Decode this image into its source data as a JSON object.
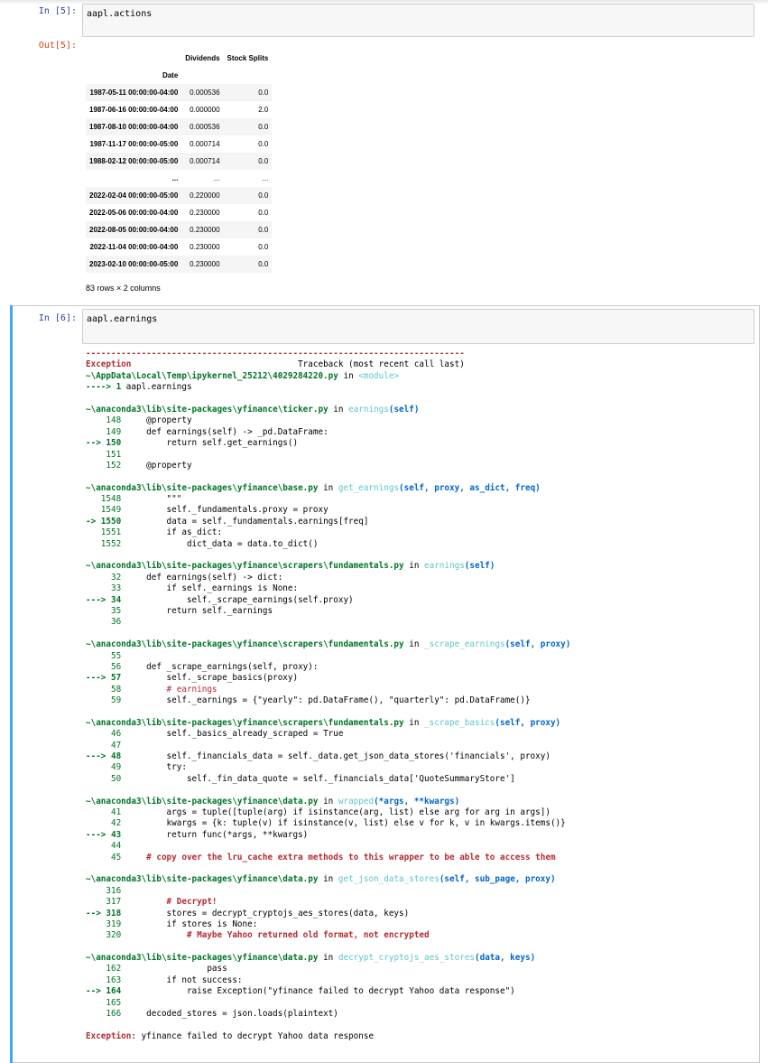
{
  "cells": [
    {
      "prompt_in": "In [5]:",
      "code": "aapl.actions",
      "prompt_out": "Out[5]:"
    },
    {
      "prompt_in": "In [6]:",
      "code": "aapl.earnings"
    }
  ],
  "table": {
    "columns": [
      "Dividends",
      "Stock Splits"
    ],
    "index_name": "Date",
    "rows": [
      [
        "1987-05-11 00:00:00-04:00",
        "0.000536",
        "0.0"
      ],
      [
        "1987-06-16 00:00:00-04:00",
        "0.000000",
        "2.0"
      ],
      [
        "1987-08-10 00:00:00-04:00",
        "0.000536",
        "0.0"
      ],
      [
        "1987-11-17 00:00:00-05:00",
        "0.000714",
        "0.0"
      ],
      [
        "1988-02-12 00:00:00-05:00",
        "0.000714",
        "0.0"
      ],
      [
        "...",
        "...",
        "..."
      ],
      [
        "2022-02-04 00:00:00-05:00",
        "0.220000",
        "0.0"
      ],
      [
        "2022-05-06 00:00:00-04:00",
        "0.230000",
        "0.0"
      ],
      [
        "2022-08-05 00:00:00-04:00",
        "0.230000",
        "0.0"
      ],
      [
        "2022-11-04 00:00:00-04:00",
        "0.230000",
        "0.0"
      ],
      [
        "2023-02-10 00:00:00-05:00",
        "0.230000",
        "0.0"
      ]
    ],
    "shape_text": "83 rows × 2 columns"
  },
  "traceback": [
    [
      [
        "---------------------------------------------------------------------------",
        "red"
      ]
    ],
    [
      [
        "Exception",
        "red"
      ],
      [
        "                                 Traceback (most recent call last)",
        ""
      ]
    ],
    [
      [
        "~\\AppData\\Local\\Temp\\ipykernel_25212\\4029284220.py",
        "grn"
      ],
      [
        " in ",
        ""
      ],
      [
        "<module>",
        "cyan"
      ]
    ],
    [
      [
        "----> 1",
        "grn"
      ],
      [
        " aapl.earnings",
        ""
      ]
    ],
    [
      [
        "",
        ""
      ]
    ],
    [
      [
        "~\\anaconda3\\lib\\site-packages\\yfinance\\ticker.py",
        "grn"
      ],
      [
        " in ",
        ""
      ],
      [
        "earnings",
        "cyan"
      ],
      [
        "(self)",
        "blu"
      ]
    ],
    [
      [
        "    148",
        "grnn"
      ],
      [
        "     @property",
        ""
      ]
    ],
    [
      [
        "    149",
        "grnn"
      ],
      [
        "     def earnings(self) -> _pd.DataFrame:",
        ""
      ]
    ],
    [
      [
        "--> 150",
        "grn"
      ],
      [
        "         return self.get_earnings()",
        ""
      ]
    ],
    [
      [
        "    151",
        "grnn"
      ],
      [
        "",
        ""
      ]
    ],
    [
      [
        "    152",
        "grnn"
      ],
      [
        "     @property",
        ""
      ]
    ],
    [
      [
        "",
        ""
      ]
    ],
    [
      [
        "~\\anaconda3\\lib\\site-packages\\yfinance\\base.py",
        "grn"
      ],
      [
        " in ",
        ""
      ],
      [
        "get_earnings",
        "cyan"
      ],
      [
        "(self, proxy, as_dict, freq)",
        "blu"
      ]
    ],
    [
      [
        "   1548",
        "grnn"
      ],
      [
        "         \"\"\"",
        ""
      ]
    ],
    [
      [
        "   1549",
        "grnn"
      ],
      [
        "         self._fundamentals.proxy = proxy",
        ""
      ]
    ],
    [
      [
        "-> 1550",
        "grn"
      ],
      [
        "         data = self._fundamentals.earnings[freq]",
        ""
      ]
    ],
    [
      [
        "   1551",
        "grnn"
      ],
      [
        "         if as_dict:",
        ""
      ]
    ],
    [
      [
        "   1552",
        "grnn"
      ],
      [
        "             dict_data = data.to_dict()",
        ""
      ]
    ],
    [
      [
        "",
        ""
      ]
    ],
    [
      [
        "~\\anaconda3\\lib\\site-packages\\yfinance\\scrapers\\fundamentals.py",
        "grn"
      ],
      [
        " in ",
        ""
      ],
      [
        "earnings",
        "cyan"
      ],
      [
        "(self)",
        "blu"
      ]
    ],
    [
      [
        "     32",
        "grnn"
      ],
      [
        "     def earnings(self) -> dict:",
        ""
      ]
    ],
    [
      [
        "     33",
        "grnn"
      ],
      [
        "         if self._earnings is None:",
        ""
      ]
    ],
    [
      [
        "---> 34",
        "grn"
      ],
      [
        "             self._scrape_earnings(self.proxy)",
        ""
      ]
    ],
    [
      [
        "     35",
        "grnn"
      ],
      [
        "         return self._earnings",
        ""
      ]
    ],
    [
      [
        "     36",
        "grnn"
      ],
      [
        "",
        ""
      ]
    ],
    [
      [
        "",
        ""
      ]
    ],
    [
      [
        "~\\anaconda3\\lib\\site-packages\\yfinance\\scrapers\\fundamentals.py",
        "grn"
      ],
      [
        " in ",
        ""
      ],
      [
        "_scrape_earnings",
        "cyan"
      ],
      [
        "(self, proxy)",
        "blu"
      ]
    ],
    [
      [
        "     55",
        "grnn"
      ],
      [
        "",
        ""
      ]
    ],
    [
      [
        "     56",
        "grnn"
      ],
      [
        "     def _scrape_earnings(self, proxy):",
        ""
      ]
    ],
    [
      [
        "---> 57",
        "grn"
      ],
      [
        "         self._scrape_basics(proxy)",
        ""
      ]
    ],
    [
      [
        "     58",
        "grnn"
      ],
      [
        "         # earnings",
        "redn"
      ]
    ],
    [
      [
        "     59",
        "grnn"
      ],
      [
        "         self._earnings = {\"yearly\": pd.DataFrame(), \"quarterly\": pd.DataFrame()}",
        ""
      ]
    ],
    [
      [
        "",
        ""
      ]
    ],
    [
      [
        "~\\anaconda3\\lib\\site-packages\\yfinance\\scrapers\\fundamentals.py",
        "grn"
      ],
      [
        " in ",
        ""
      ],
      [
        "_scrape_basics",
        "cyan"
      ],
      [
        "(self, proxy)",
        "blu"
      ]
    ],
    [
      [
        "     46",
        "grnn"
      ],
      [
        "         self._basics_already_scraped = True",
        ""
      ]
    ],
    [
      [
        "     47",
        "grnn"
      ],
      [
        "",
        ""
      ]
    ],
    [
      [
        "---> 48",
        "grn"
      ],
      [
        "         self._financials_data = self._data.get_json_data_stores('financials', proxy)",
        ""
      ]
    ],
    [
      [
        "     49",
        "grnn"
      ],
      [
        "         try:",
        ""
      ]
    ],
    [
      [
        "     50",
        "grnn"
      ],
      [
        "             self._fin_data_quote = self._financials_data['QuoteSummaryStore']",
        ""
      ]
    ],
    [
      [
        "",
        ""
      ]
    ],
    [
      [
        "~\\anaconda3\\lib\\site-packages\\yfinance\\data.py",
        "grn"
      ],
      [
        " in ",
        ""
      ],
      [
        "wrapped",
        "cyan"
      ],
      [
        "(*args, **kwargs)",
        "blu"
      ]
    ],
    [
      [
        "     41",
        "grnn"
      ],
      [
        "         args = tuple([tuple(arg) if isinstance(arg, list) else arg for arg in args])",
        ""
      ]
    ],
    [
      [
        "     42",
        "grnn"
      ],
      [
        "         kwargs = {k: tuple(v) if isinstance(v, list) else v for k, v in kwargs.items()}",
        ""
      ]
    ],
    [
      [
        "---> 43",
        "grn"
      ],
      [
        "         return func(*args, **kwargs)",
        ""
      ]
    ],
    [
      [
        "     44",
        "grnn"
      ],
      [
        "",
        ""
      ]
    ],
    [
      [
        "     45",
        "grnn"
      ],
      [
        "     # copy over the lru_cache extra methods to this wrapper to be able to access them",
        "red"
      ]
    ],
    [
      [
        "",
        ""
      ]
    ],
    [
      [
        "~\\anaconda3\\lib\\site-packages\\yfinance\\data.py",
        "grn"
      ],
      [
        " in ",
        ""
      ],
      [
        "get_json_data_stores",
        "cyan"
      ],
      [
        "(self, sub_page, proxy)",
        "blu"
      ]
    ],
    [
      [
        "    316",
        "grnn"
      ],
      [
        "",
        ""
      ]
    ],
    [
      [
        "    317",
        "grnn"
      ],
      [
        "         # Decrypt!",
        "red"
      ]
    ],
    [
      [
        "--> 318",
        "grn"
      ],
      [
        "         stores = decrypt_cryptojs_aes_stores(data, keys)",
        ""
      ]
    ],
    [
      [
        "    319",
        "grnn"
      ],
      [
        "         if stores is None:",
        ""
      ]
    ],
    [
      [
        "    320",
        "grnn"
      ],
      [
        "             # Maybe Yahoo returned old format, not encrypted",
        "red"
      ]
    ],
    [
      [
        "",
        ""
      ]
    ],
    [
      [
        "~\\anaconda3\\lib\\site-packages\\yfinance\\data.py",
        "grn"
      ],
      [
        " in ",
        ""
      ],
      [
        "decrypt_cryptojs_aes_stores",
        "cyan"
      ],
      [
        "(data, keys)",
        "blu"
      ]
    ],
    [
      [
        "    162",
        "grnn"
      ],
      [
        "                 pass",
        ""
      ]
    ],
    [
      [
        "    163",
        "grnn"
      ],
      [
        "         if not success:",
        ""
      ]
    ],
    [
      [
        "--> 164",
        "grn"
      ],
      [
        "             raise Exception(\"yfinance failed to decrypt Yahoo data response\")",
        ""
      ]
    ],
    [
      [
        "    165",
        "grnn"
      ],
      [
        "",
        ""
      ]
    ],
    [
      [
        "    166",
        "grnn"
      ],
      [
        "     decoded_stores = json.loads(plaintext)",
        ""
      ]
    ],
    [
      [
        "",
        ""
      ]
    ],
    [
      [
        "Exception",
        "red"
      ],
      [
        ": yfinance failed to decrypt Yahoo data response",
        ""
      ]
    ]
  ]
}
